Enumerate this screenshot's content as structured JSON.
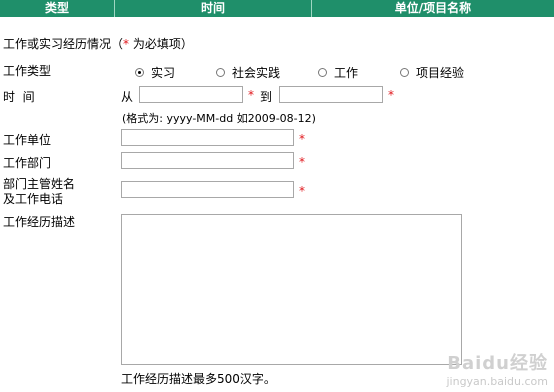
{
  "header": {
    "col1": "类型",
    "col2": "时间",
    "col3": "单位/项目名称"
  },
  "section_title": "工作或实习经历情况（",
  "section_title_req": "*",
  "section_title_tail": " 为必填项）",
  "work_type": {
    "label": "工作类型",
    "options": [
      "实习",
      "社会实践",
      "工作",
      "项目经验"
    ],
    "selected": "实习"
  },
  "time": {
    "label": "时  间",
    "from_label": "从",
    "to_label": "到",
    "from_value": "",
    "to_value": "",
    "format_hint": "(格式为: yyyy-MM-dd 如2009-08-12)"
  },
  "work_unit": {
    "label": "工作单位",
    "value": ""
  },
  "work_dept": {
    "label": "工作部门",
    "value": ""
  },
  "supervisor": {
    "label_line1": "部门主管姓名",
    "label_line2": "及工作电话",
    "value": ""
  },
  "description": {
    "label": "工作经历描述",
    "value": "",
    "hint": "工作经历描述最多500汉字。"
  },
  "required_mark": "*",
  "watermark": {
    "logo": "Baidu经验",
    "url": "jingyan.baidu.com"
  }
}
